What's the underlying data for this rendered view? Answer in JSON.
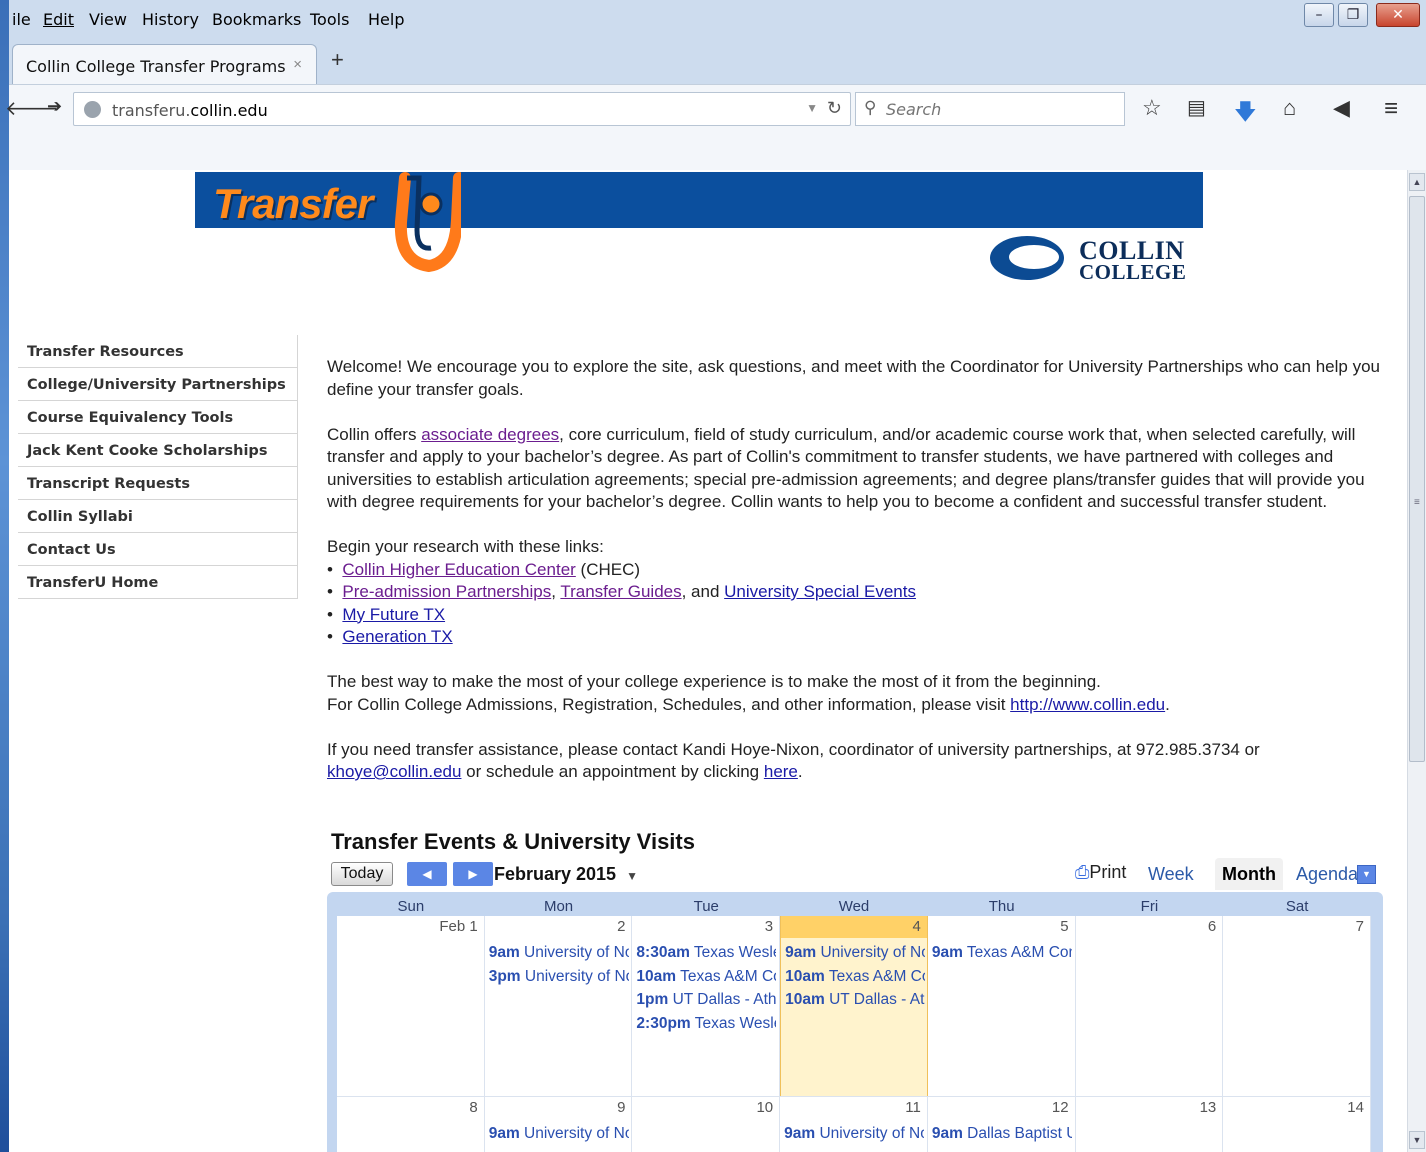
{
  "menubar": {
    "items": [
      "ile",
      "Edit",
      "View",
      "History",
      "Bookmarks",
      "Tools",
      "Help"
    ]
  },
  "window_controls": {
    "minimize": "–",
    "restore": "❐",
    "close": "✕"
  },
  "tab": {
    "title": "Collin College Transfer Programs",
    "close": "×",
    "new_tab": "+"
  },
  "navbar": {
    "url_domain_prefix": "transferu.",
    "url_domain_main": "collin.edu",
    "search_placeholder": "Search"
  },
  "brand": {
    "transfer_word": "Transfer",
    "college_line1": "COLLIN",
    "college_line2": "COLLEGE"
  },
  "sidebar": {
    "items": [
      {
        "label": "Transfer Resources"
      },
      {
        "label": "College/University Partnerships"
      },
      {
        "label": "Course Equivalency Tools"
      },
      {
        "label": "Jack Kent Cooke Scholarships"
      },
      {
        "label": "Transcript Requests"
      },
      {
        "label": "Collin Syllabi"
      },
      {
        "label": "Contact Us"
      },
      {
        "label": "TransferU Home"
      }
    ]
  },
  "main": {
    "p1": "Welcome! We encourage you to explore the site, ask questions, and meet with the Coordinator for University Partnerships who can help you define your transfer goals.",
    "p2_before": "Collin offers ",
    "p2_link": "associate degrees",
    "p2_after": ", core curriculum, field of study curriculum, and/or academic course work that, when selected carefully, will transfer and apply to your bachelor’s degree. As part of Collin's commitment to transfer students, we have partnered with colleges and universities to establish articulation agreements; special pre-admission agreements; and degree plans/transfer guides that will provide you with degree requirements for your bachelor’s degree. Collin wants to help you to become a confident and successful transfer student.",
    "links_intro": "Begin your research with these links:",
    "link_chec": "Collin Higher Education Center",
    "chec_suffix": " (CHEC)",
    "link_preadmission": "Pre-admission Partnerships",
    "link_guides": "Transfer Guides",
    "and_text": ", and ",
    "link_events": "University Special Events",
    "link_myfuture": "My Future TX",
    "link_generation": "Generation TX",
    "p4_line1": "The best way to make the most of your college experience is to make the most of it from the beginning.",
    "p4_line2_before": "For Collin College Admissions, Registration, Schedules, and other information, please visit ",
    "p4_link": "http://www.collin.edu",
    "p5_before": "If you need transfer assistance, please contact Kandi Hoye-Nixon, coordinator of university partnerships, at 972.985.3734 or ",
    "p5_email": "khoye@collin.edu",
    "p5_middle": " or schedule an appointment by clicking ",
    "p5_link": "here",
    "period": "."
  },
  "calendar": {
    "title": "Transfer Events & University Visits",
    "today": "Today",
    "month": "February 2015",
    "print": "Print",
    "views": [
      "Week",
      "Month",
      "Agenda"
    ],
    "active_view": "Month",
    "daynames": [
      "Sun",
      "Mon",
      "Tue",
      "Wed",
      "Thu",
      "Fri",
      "Sat"
    ],
    "week1": {
      "days": [
        "Feb 1",
        "2",
        "3",
        "4",
        "5",
        "6",
        "7"
      ],
      "today_index": 3,
      "events": [
        [],
        [
          {
            "time": "9am",
            "text": " University of North Texas"
          },
          {
            "time": "3pm",
            "text": " University of North Texas"
          }
        ],
        [
          {
            "time": "8:30am",
            "text": " Texas Wesleyan"
          },
          {
            "time": "10am",
            "text": " Texas A&M Commerce"
          },
          {
            "time": "1pm",
            "text": " UT Dallas - Athletics"
          },
          {
            "time": "2:30pm",
            "text": " Texas Wesleyan"
          }
        ],
        [
          {
            "time": "9am",
            "text": " University of North Texas"
          },
          {
            "time": "10am",
            "text": " Texas A&M Commerce"
          },
          {
            "time": "10am",
            "text": " UT Dallas - Athletics"
          }
        ],
        [
          {
            "time": "9am",
            "text": " Texas A&M Commerce"
          }
        ],
        [],
        []
      ]
    },
    "week2": {
      "days": [
        "8",
        "9",
        "10",
        "11",
        "12",
        "13",
        "14"
      ],
      "events": [
        [],
        [
          {
            "time": "9am",
            "text": " University of North Texas"
          }
        ],
        [],
        [
          {
            "time": "9am",
            "text": " University of North Texas"
          }
        ],
        [
          {
            "time": "9am",
            "text": " Dallas Baptist University"
          }
        ],
        [],
        []
      ]
    }
  }
}
